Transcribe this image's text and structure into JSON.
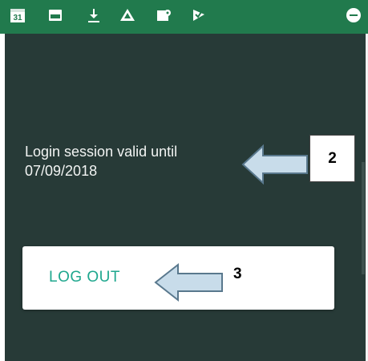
{
  "status_bar": {
    "background": "#217a4d",
    "calendar_label": "31",
    "icons": [
      "calendar-icon",
      "image-icon",
      "download-icon",
      "drive-icon",
      "map-icon",
      "check-flag-icon",
      "minus-circle-icon"
    ]
  },
  "panel": {
    "background": "#273a37",
    "session_line_1": "Login session valid until",
    "session_line_2": "07/09/2018",
    "logout_label": "LOG OUT",
    "accent_color": "#1fa78e"
  },
  "annotations": {
    "callout_2": "2",
    "callout_3": "3",
    "arrow_color": "#c8dcea"
  }
}
